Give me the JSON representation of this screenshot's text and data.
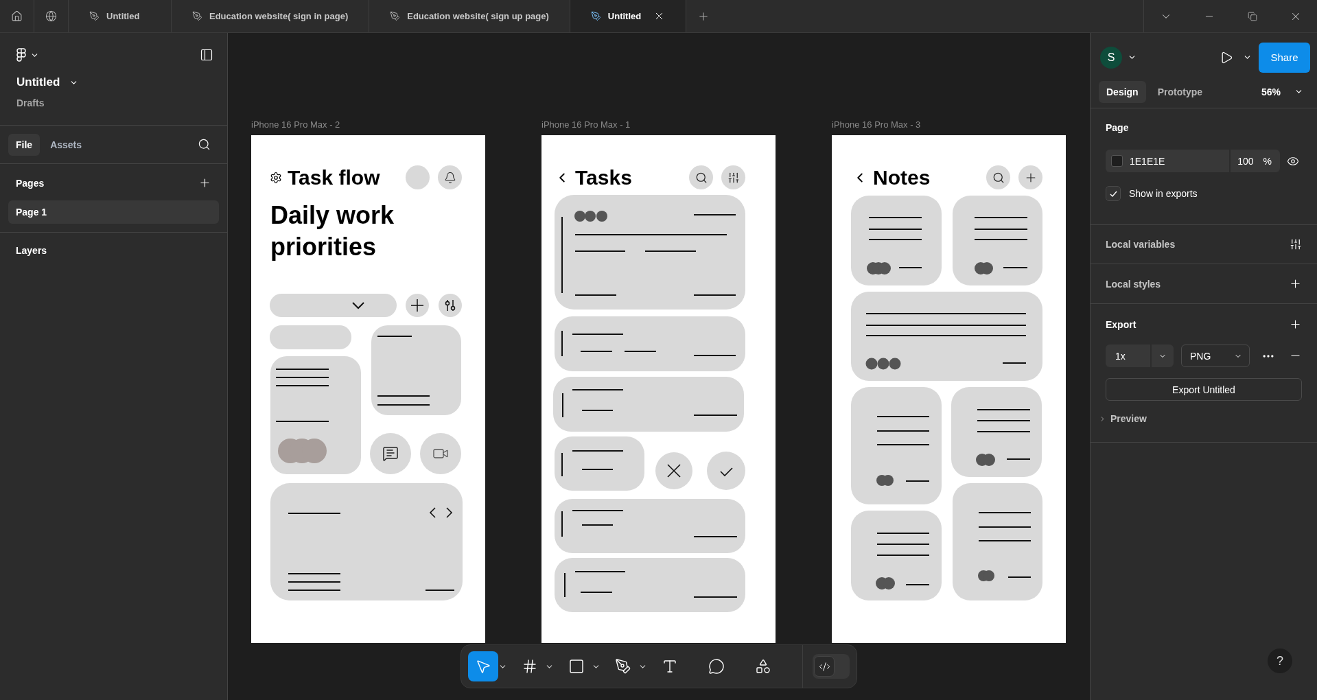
{
  "top_bar": {
    "tabs": [
      {
        "title": "Untitled",
        "selected": false
      },
      {
        "title": "Education website( sign in page)",
        "selected": false
      },
      {
        "title": "Education website( sign up page)",
        "selected": false
      },
      {
        "title": "Untitled",
        "selected": true
      }
    ]
  },
  "left_panel": {
    "file_name": "Untitled",
    "location": "Drafts",
    "tabs": [
      {
        "label": "File",
        "selected": true
      },
      {
        "label": "Assets",
        "selected": false
      }
    ],
    "pages_title": "Pages",
    "pages": [
      {
        "name": "Page 1",
        "selected": true
      }
    ],
    "layers_title": "Layers"
  },
  "canvas": {
    "frames": [
      {
        "label": "iPhone 16 Pro Max - 2",
        "kind": "dashboard",
        "title": "Task flow",
        "heading": "Daily work priorities"
      },
      {
        "label": "iPhone 16 Pro Max - 1",
        "kind": "task-list",
        "title": "Tasks"
      },
      {
        "label": "iPhone 16 Pro Max - 3",
        "kind": "notes",
        "title": "Notes"
      }
    ]
  },
  "toolbar": {
    "tools": [
      {
        "kind": "move",
        "selected": true,
        "has_menu": true
      },
      {
        "kind": "frame",
        "selected": false,
        "has_menu": true
      },
      {
        "kind": "rectangle",
        "selected": false,
        "has_menu": true
      },
      {
        "kind": "pen",
        "selected": false,
        "has_menu": true
      },
      {
        "kind": "text",
        "selected": false,
        "has_menu": false
      },
      {
        "kind": "comment",
        "selected": false,
        "has_menu": false
      },
      {
        "kind": "actions",
        "selected": false,
        "has_menu": false
      }
    ],
    "dev_mode": {
      "on": false
    }
  },
  "right_panel": {
    "avatar": "S",
    "share": "Share",
    "tabs": [
      {
        "label": "Design",
        "selected": true
      },
      {
        "label": "Prototype",
        "selected": false
      }
    ],
    "zoom": "56%",
    "page_section": {
      "title": "Page",
      "color": "1E1E1E",
      "opacity": "100",
      "percent": "%",
      "show_in_exports": {
        "label": "Show in exports",
        "checked": true
      }
    },
    "local_variables": "Local variables",
    "local_styles": "Local styles",
    "export": {
      "title": "Export",
      "scale": "1x",
      "format": "PNG",
      "button": "Export Untitled",
      "preview": "Preview"
    }
  },
  "help": "?"
}
